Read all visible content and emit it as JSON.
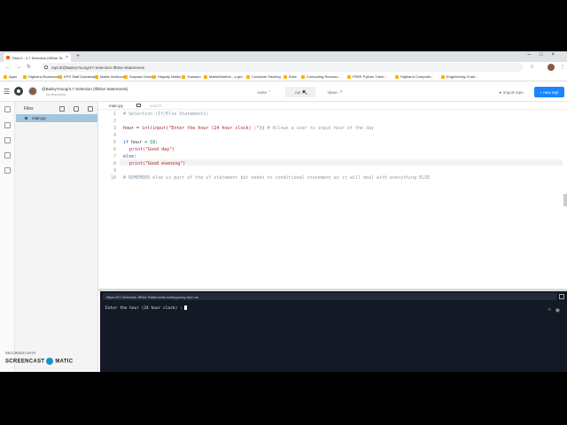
{
  "browser": {
    "tab_title": "Repl.it - 4.7 Selection (If/Else St...",
    "address": "repl.it/@BaileyYoung/47-Selection-IfElse-Statements",
    "bookmarks": [
      "Apps",
      "Highland Bookmarks",
      "KPS Staff Dashboard",
      "Maths Workout",
      "Surpass Home",
      "Hegarty Maths",
      "Transum",
      "MathsStarters - a gre...",
      "Container Packing",
      "iDice",
      "Computing Resourc...",
      "FREE Python Tutori...",
      "Highland Computin...",
      "Engineering Chall..."
    ]
  },
  "repl": {
    "title": "@BaileyYoung/4.7 Selection (If/Else Statements)",
    "description": "No description",
    "invite_label": "invite",
    "run_label": "run",
    "share_label": "share",
    "import_label": "import repo",
    "new_repl_label": "+ new repl"
  },
  "sidebar": {
    "title": "Files",
    "file": "main.py"
  },
  "editor": {
    "tab": "main.py",
    "search_placeholder": "search",
    "line_numbers": [
      "1",
      "2",
      "3",
      "4",
      "5",
      "6",
      "7",
      "8",
      "9",
      "10"
    ],
    "lines": {
      "l1": "# Selection (If/Else Statements)",
      "l3_var": "hour = ",
      "l3_int": "int",
      "l3_paren": "(",
      "l3_input": "input",
      "l3_str": "\"Enter the hour (24 hour clock) :\"",
      "l3_close": ")) ",
      "l3_cm": "# Allows a user to input hour of the day",
      "l5_if": "if",
      "l5_rest": " hour < ",
      "l5_num": "18",
      "l5_colon": ":",
      "l6_print": "print",
      "l6_str": "(\"Good day\")",
      "l7_else": "else",
      "l7_colon": ":",
      "l8_print": "print",
      "l8_str": "(\"Good evening\")",
      "l10": "# REMEMBER else is part of the if statement but needs no conditional statement as it will deal with everything ELSE"
    }
  },
  "console": {
    "url": "https://47-Selection-IfElse-Statements.baileyyoung.repl.run",
    "output": "Enter the hour (24 hour clock) :"
  },
  "watermark": {
    "recorded": "RECORDED WITH",
    "brand_left": "SCREENCAST",
    "brand_right": "MATIC"
  }
}
